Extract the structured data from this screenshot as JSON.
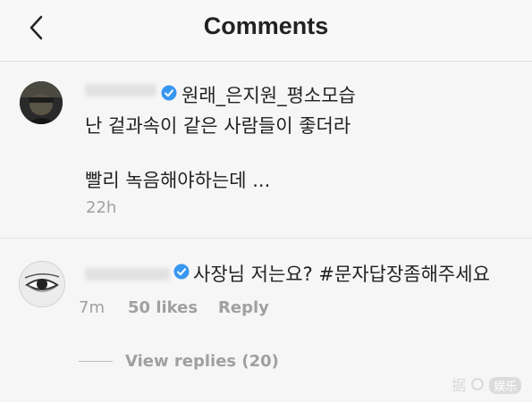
{
  "header": {
    "title": "Comments"
  },
  "comments": [
    {
      "username": "원래_은지원_평소모습",
      "lines": [
        "난 겉과속이 같은 사람들이 좋더라",
        "빨리 녹음해야하는데 ..."
      ],
      "time": "22h"
    },
    {
      "text": "사장님 저는요? #문자답장좀해주세요",
      "time": "7m",
      "likes": "50 likes",
      "reply": "Reply",
      "view_replies": "View replies (20)"
    }
  ],
  "watermark": {
    "prefix": "据",
    "badge": "娱乐"
  },
  "colors": {
    "verified": "#3897f0",
    "meta": "#a0a0a0"
  }
}
